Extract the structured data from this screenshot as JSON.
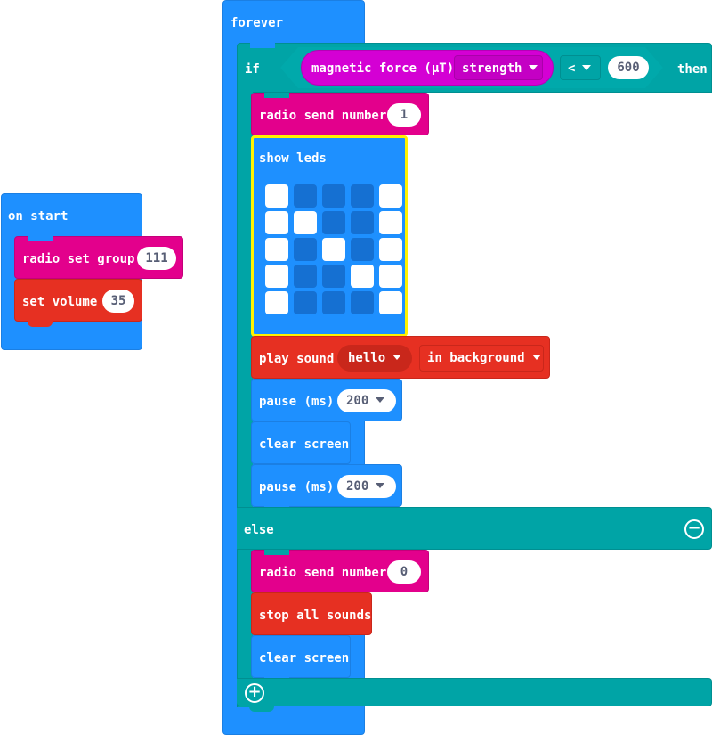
{
  "on_start": {
    "label": "on start",
    "radio_set_group": {
      "label": "radio set group",
      "value": "111"
    },
    "set_volume": {
      "label": "set volume",
      "value": "35"
    }
  },
  "forever": {
    "label": "forever",
    "if_block": {
      "if_label": "if",
      "then_label": "then",
      "else_label": "else",
      "condition": {
        "sensor_label": "magnetic force (µT)",
        "axis_option": "strength",
        "operator": "<",
        "value": "600"
      },
      "then_branch": {
        "radio_send": {
          "label": "radio send number",
          "value": "1"
        },
        "show_leds": {
          "label": "show leds",
          "grid": [
            [
              1,
              0,
              0,
              0,
              1
            ],
            [
              1,
              1,
              0,
              0,
              1
            ],
            [
              1,
              0,
              1,
              0,
              1
            ],
            [
              1,
              0,
              0,
              1,
              1
            ],
            [
              1,
              0,
              0,
              0,
              1
            ]
          ]
        },
        "play_sound": {
          "label": "play sound",
          "sound": "hello",
          "mode": "in background"
        },
        "pause1": {
          "label": "pause (ms)",
          "value": "200"
        },
        "clear_screen": {
          "label": "clear screen"
        },
        "pause2": {
          "label": "pause (ms)",
          "value": "200"
        }
      },
      "else_branch": {
        "radio_send": {
          "label": "radio send number",
          "value": "0"
        },
        "stop_sounds": {
          "label": "stop all sounds"
        },
        "clear_screen": {
          "label": "clear screen"
        }
      }
    }
  },
  "colors": {
    "events": "#1E90FF",
    "radio": "#E3008C",
    "music": "#E63022",
    "logic": "#00A4A6",
    "input": "#D400D4",
    "highlight": "#FFF200"
  }
}
